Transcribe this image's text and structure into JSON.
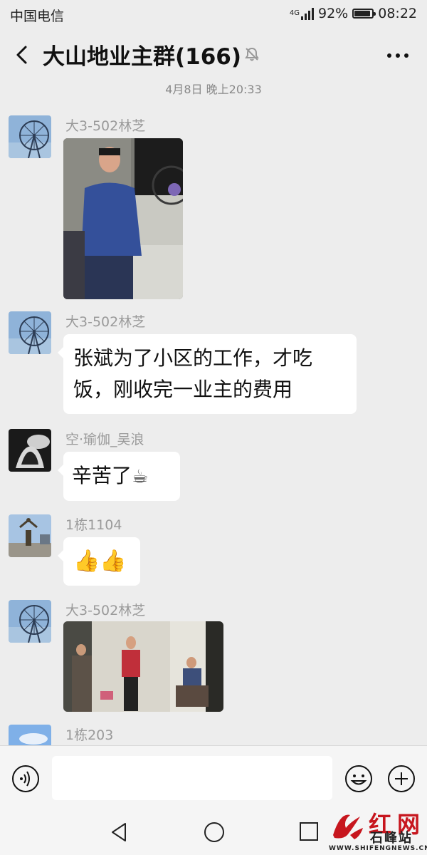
{
  "status_bar": {
    "carrier": "中国电信",
    "network": "4G",
    "battery": "92%",
    "battery_level": 0.92,
    "time": "08:22"
  },
  "header": {
    "title": "大山地业主群(166)",
    "back_icon": "chevron-left-icon",
    "mute_icon": "bell-off-icon",
    "more_icon": "more-icon"
  },
  "timestamp": "4月8日 晚上20:33",
  "messages": [
    {
      "sender": "大3-502林芝",
      "type": "image",
      "content": "",
      "avatar": "ferris-wheel-photo"
    },
    {
      "sender": "大3-502林芝",
      "type": "text",
      "lines": [
        "张斌为了小区的工作，才吃",
        "饭，刚收完一业主的费用"
      ],
      "avatar": "ferris-wheel-photo"
    },
    {
      "sender": "空·瑜伽_吴浪",
      "type": "text",
      "lines": [
        "辛苦了"
      ],
      "emoji": "☕",
      "avatar": "yoga-photo"
    },
    {
      "sender": "1栋1104",
      "type": "emoji",
      "emoji": "👍👍",
      "avatar": "statue-photo"
    },
    {
      "sender": "大3-502林芝",
      "type": "image",
      "content": "",
      "avatar": "ferris-wheel-photo"
    },
    {
      "sender": "1栋203",
      "type": "partial",
      "avatar": "sky-photo"
    }
  ],
  "input_bar": {
    "placeholder": "",
    "voice_icon": "voice-icon",
    "emoji_icon": "emoji-icon",
    "plus_icon": "plus-icon"
  },
  "nav_bar": {
    "back_icon": "nav-back-icon",
    "home_icon": "nav-home-icon",
    "recent_icon": "nav-recent-icon"
  },
  "watermark": {
    "title": "红网",
    "subtitle": "石峰站",
    "url": "WWW.SHIFENGNEWS.CN",
    "brand_color": "#c7161e"
  },
  "colors": {
    "background": "#ededed",
    "bubble": "#ffffff",
    "sender_name": "#9a9a9a"
  }
}
